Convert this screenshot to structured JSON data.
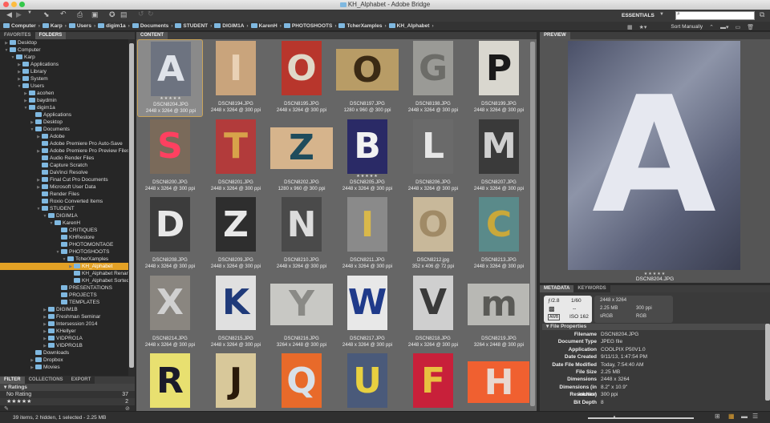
{
  "window": {
    "title": "KH_Alphabet - Adobe Bridge"
  },
  "toolbar": {
    "workspace": "ESSENTIALS",
    "search_placeholder": "",
    "sort_label": "Sort Manually"
  },
  "path": [
    "Computer",
    "Karp",
    "Users",
    "digim1a",
    "Documents",
    "STUDENT",
    "DIGIM1A",
    "KarenH",
    "PHOTOSHOOTS",
    "TcherXamples",
    "KH_Alphabet"
  ],
  "left_tabs": [
    "FAVORITES",
    "FOLDERS"
  ],
  "tree": [
    [
      "Desktop",
      0,
      "closed"
    ],
    [
      "Computer",
      0,
      "open"
    ],
    [
      "Karp",
      1,
      "open"
    ],
    [
      "Applications",
      2,
      "closed"
    ],
    [
      "Library",
      2,
      "closed"
    ],
    [
      "System",
      2,
      "closed"
    ],
    [
      "Users",
      2,
      "open"
    ],
    [
      "acohen",
      3,
      "closed"
    ],
    [
      "baydmin",
      3,
      "closed"
    ],
    [
      "digim1a",
      3,
      "open"
    ],
    [
      "Applications",
      4,
      "none"
    ],
    [
      "Desktop",
      4,
      "closed"
    ],
    [
      "Documents",
      4,
      "open"
    ],
    [
      "Adobe",
      5,
      "closed"
    ],
    [
      "Adobe Premiere Pro Auto-Save",
      5,
      "none"
    ],
    [
      "Adobe Premiere Pro Preview Files",
      5,
      "closed"
    ],
    [
      "Audio Render Files",
      5,
      "none"
    ],
    [
      "Capture Scratch",
      5,
      "none"
    ],
    [
      "DaVinci Resolve",
      5,
      "none"
    ],
    [
      "Final Cut Pro Documents",
      5,
      "closed"
    ],
    [
      "Microsoft User Data",
      5,
      "closed"
    ],
    [
      "Render Files",
      5,
      "none"
    ],
    [
      "Roxio Converted Items",
      5,
      "none"
    ],
    [
      "STUDENT",
      5,
      "open"
    ],
    [
      "DIGIM1A",
      6,
      "open"
    ],
    [
      "KarenH",
      7,
      "open"
    ],
    [
      "CRITIQUES",
      8,
      "none"
    ],
    [
      "KHRestore",
      8,
      "none"
    ],
    [
      "PHOTOMONTAGE",
      8,
      "none"
    ],
    [
      "PHOTOSHOOTS",
      8,
      "open"
    ],
    [
      "TcherXamples",
      9,
      "open"
    ],
    [
      "KH_Alphabet",
      10,
      "closed"
    ],
    [
      "KH_Alphabet Renamed",
      10,
      "none"
    ],
    [
      "KH_Alphabet Sorted",
      10,
      "none"
    ],
    [
      "PRESENTATIONS",
      8,
      "none"
    ],
    [
      "PROJECTS",
      8,
      "none"
    ],
    [
      "TEMPLATES",
      8,
      "none"
    ],
    [
      "DIGIM1B",
      6,
      "closed"
    ],
    [
      "Freshman Seminar",
      6,
      "closed"
    ],
    [
      "Intersession 2014",
      6,
      "closed"
    ],
    [
      "KHellyer",
      6,
      "closed"
    ],
    [
      "VIDPRO1A",
      6,
      "closed"
    ],
    [
      "VIDPRO1B",
      6,
      "closed"
    ],
    [
      "Downloads",
      4,
      "none"
    ],
    [
      "Dropbox",
      4,
      "closed"
    ],
    [
      "Movies",
      4,
      "closed"
    ]
  ],
  "selected_folder": "KH_Alphabet",
  "filter": {
    "tabs": [
      "FILTER",
      "COLLECTIONS",
      "EXPORT"
    ],
    "section": "Ratings",
    "rows": [
      {
        "label": "No Rating",
        "count": "37"
      },
      {
        "label": "★★★★★",
        "count": "2"
      }
    ]
  },
  "content": {
    "tab": "CONTENT",
    "items": [
      {
        "name": "DSCN8204.JPG",
        "info": "2448 x 3264 @ 300 ppi",
        "letter": "A",
        "bg": "#6d7380",
        "fg": "#dfe3ea",
        "shape": "portrait",
        "stars": "★★★★★",
        "selected": true
      },
      {
        "name": "DSCN8194.JPG",
        "info": "2448 x 3264 @ 300 ppi",
        "letter": "I",
        "bg": "#c9a47c",
        "fg": "#e9d1b5",
        "shape": "portrait"
      },
      {
        "name": "DSCN8195.JPG",
        "info": "2448 x 3264 @ 300 ppi",
        "letter": "O",
        "bg": "#b8362c",
        "fg": "#e0d8c8",
        "shape": "portrait"
      },
      {
        "name": "DSCN8197.JPG",
        "info": "1280 x 960 @ 300 ppi",
        "letter": "O",
        "bg": "#b89c66",
        "fg": "#3b2a14",
        "shape": "landscape"
      },
      {
        "name": "DSCN8198.JPG",
        "info": "2448 x 3264 @ 300 ppi",
        "letter": "G",
        "bg": "#9a9a96",
        "fg": "#6c6c68",
        "shape": "portrait"
      },
      {
        "name": "DSCN8199.JPG",
        "info": "2448 x 3264 @ 300 ppi",
        "letter": "P",
        "bg": "#d9d7cf",
        "fg": "#1a1a1a",
        "shape": "portrait"
      },
      {
        "name": "DSCN8200.JPG",
        "info": "2448 x 3264 @ 300 ppi",
        "letter": "S",
        "bg": "#7a6a5a",
        "fg": "#ff4060",
        "shape": "portrait"
      },
      {
        "name": "DSCN8201.JPG",
        "info": "2448 x 3264 @ 300 ppi",
        "letter": "T",
        "bg": "#b23b3b",
        "fg": "#d8a24a",
        "shape": "portrait"
      },
      {
        "name": "DSCN8202.JPG",
        "info": "1280 x 960 @ 300 ppi",
        "letter": "Z",
        "bg": "#d6b48c",
        "fg": "#1f4c5c",
        "shape": "landscape"
      },
      {
        "name": "DSCN8205.JPG",
        "info": "2448 x 3264 @ 300 ppi",
        "letter": "B",
        "bg": "#2a2a66",
        "fg": "#f2f2f2",
        "shape": "portrait",
        "stars": "★★★★★"
      },
      {
        "name": "DSCN8206.JPG",
        "info": "2448 x 3264 @ 300 ppi",
        "letter": "L",
        "bg": "#6a6a6a",
        "fg": "#e6e6e6",
        "shape": "portrait"
      },
      {
        "name": "DSCN8207.JPG",
        "info": "2448 x 3264 @ 300 ppi",
        "letter": "M",
        "bg": "#3a3a3a",
        "fg": "#cfcfcf",
        "shape": "portrait"
      },
      {
        "name": "DSCN8208.JPG",
        "info": "2448 x 3264 @ 300 ppi",
        "letter": "D",
        "bg": "#3c3c3c",
        "fg": "#e8e8e8",
        "shape": "portrait"
      },
      {
        "name": "DSCN8209.JPG",
        "info": "2448 x 3264 @ 300 ppi",
        "letter": "Z",
        "bg": "#2e2e2e",
        "fg": "#e8e8e8",
        "shape": "portrait"
      },
      {
        "name": "DSCN8210.JPG",
        "info": "2448 x 3264 @ 300 ppi",
        "letter": "N",
        "bg": "#4a4a4a",
        "fg": "#dcdcdc",
        "shape": "portrait"
      },
      {
        "name": "DSCN8211.JPG",
        "info": "2448 x 3264 @ 300 ppi",
        "letter": "I",
        "bg": "#8a8a8a",
        "fg": "#d9b84a",
        "shape": "portrait"
      },
      {
        "name": "DSCN8212.jpg",
        "info": "352 x 406 @ 72 ppi",
        "letter": "O",
        "bg": "#c8b89a",
        "fg": "#a08a66",
        "shape": "portrait"
      },
      {
        "name": "DSCN8213.JPG",
        "info": "2448 x 3264 @ 300 ppi",
        "letter": "C",
        "bg": "#5a8a8a",
        "fg": "#c9a83a",
        "shape": "portrait"
      },
      {
        "name": "DSCN8214.JPG",
        "info": "2448 x 3264 @ 300 ppi",
        "letter": "X",
        "bg": "#8a8680",
        "fg": "#d0d0d0",
        "shape": "portrait"
      },
      {
        "name": "DSCN8215.JPG",
        "info": "2448 x 3264 @ 300 ppi",
        "letter": "K",
        "bg": "#e0e0e0",
        "fg": "#1f3a7a",
        "shape": "portrait"
      },
      {
        "name": "DSCN8216.JPG",
        "info": "3264 x 2448 @ 300 ppi",
        "letter": "Y",
        "bg": "#c8c8c4",
        "fg": "#8a8a86",
        "shape": "landscape"
      },
      {
        "name": "DSCN8217.JPG",
        "info": "2448 x 3264 @ 300 ppi",
        "letter": "W",
        "bg": "#e8e8e8",
        "fg": "#1f3a8a",
        "shape": "portrait"
      },
      {
        "name": "DSCN8218.JPG",
        "info": "2448 x 3264 @ 300 ppi",
        "letter": "V",
        "bg": "#cfcfcf",
        "fg": "#3a3a3a",
        "shape": "portrait"
      },
      {
        "name": "DSCN8219.JPG",
        "info": "3264 x 2448 @ 300 ppi",
        "letter": "m",
        "bg": "#b8b8b4",
        "fg": "#5a5a56",
        "shape": "landscape"
      },
      {
        "name": "",
        "info": "",
        "letter": "R",
        "bg": "#e8e070",
        "fg": "#1a1a2a",
        "shape": "portrait"
      },
      {
        "name": "",
        "info": "",
        "letter": "J",
        "bg": "#d8c89a",
        "fg": "#2a1a0a",
        "shape": "portrait"
      },
      {
        "name": "",
        "info": "",
        "letter": "Q",
        "bg": "#e86a2a",
        "fg": "#d8e0e8",
        "shape": "portrait"
      },
      {
        "name": "",
        "info": "",
        "letter": "U",
        "bg": "#4a5a7a",
        "fg": "#e8d040",
        "shape": "portrait"
      },
      {
        "name": "",
        "info": "",
        "letter": "F",
        "bg": "#c8203a",
        "fg": "#e8c040",
        "shape": "portrait"
      },
      {
        "name": "",
        "info": "",
        "letter": "H",
        "bg": "#f06030",
        "fg": "#e8d8d0",
        "shape": "landscape"
      }
    ]
  },
  "preview": {
    "tab": "PREVIEW",
    "caption": "DSCN8204.JPG",
    "stars": "★★★★★",
    "letter": "A"
  },
  "metadata": {
    "tabs": [
      "METADATA",
      "KEYWORDS"
    ],
    "camera": {
      "aperture": "ƒ/2.8",
      "shutter": "1/60",
      "metering": "--",
      "wb": "AWB",
      "iso": "ISO 162"
    },
    "summary": {
      "dims": "2448 x 3264",
      "size": "2.25 MB",
      "res": "300 ppi",
      "profile": "sRGB",
      "mode": "RGB"
    },
    "section": "File Properties",
    "rows": [
      {
        "k": "Filename",
        "v": "DSCN8204.JPG"
      },
      {
        "k": "Document Type",
        "v": "JPEG file"
      },
      {
        "k": "Application",
        "v": "COOLPIX P50V1.0"
      },
      {
        "k": "Date Created",
        "v": "9/11/13, 1:47:54 PM"
      },
      {
        "k": "Date File Modified",
        "v": "Today, 7:54:40 AM"
      },
      {
        "k": "File Size",
        "v": "2.25 MB"
      },
      {
        "k": "Dimensions",
        "v": "2448 x 3264"
      },
      {
        "k": "Dimensions (in inches)",
        "v": "8.2\" x 10.9\""
      },
      {
        "k": "Resolution",
        "v": "300 ppi"
      },
      {
        "k": "Bit Depth",
        "v": "8"
      }
    ]
  },
  "status": {
    "text": "39 items, 2 hidden, 1 selected - 2.25 MB",
    "thumb_zoom": 0.25
  }
}
